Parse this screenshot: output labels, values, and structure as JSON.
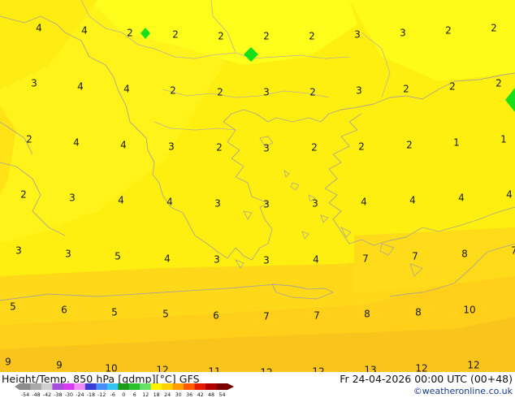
{
  "title": {
    "product": "Height/Temp. 850 hPa [gdmp][°C] GFS",
    "valid": "Fr 24-04-2026 00:00 UTC (00+48)",
    "credit": "©weatheronline.co.uk"
  },
  "colors": {
    "sea_deep": "#f7c51d",
    "field_warm": "#ffd31a",
    "field_yellow": "#ffef10",
    "field_bright": "#fffd1c",
    "coast": "#b0a78a",
    "marker": "#18e018"
  },
  "colorbar": {
    "labels": [
      "-54",
      "-48",
      "-42",
      "-38",
      "-30",
      "-24",
      "-18",
      "-12",
      "-6",
      "0",
      "6",
      "12",
      "18",
      "24",
      "30",
      "36",
      "42",
      "48",
      "54"
    ],
    "colors": [
      "#8c8c8c",
      "#a9a9a9",
      "#cfcfcf",
      "#a54fdb",
      "#d63bf0",
      "#f08cf5",
      "#3b3bd6",
      "#4a8cf5",
      "#33c4f5",
      "#1a9c1a",
      "#2ac22a",
      "#66e066",
      "#fff300",
      "#ffd000",
      "#ff9c00",
      "#ff5a00",
      "#e61a00",
      "#b00000",
      "#7a0000"
    ]
  },
  "temperature_values": [
    "4",
    "4",
    "2",
    "2",
    "2",
    "2",
    "2",
    "3",
    "3",
    "2",
    "2",
    "3",
    "4",
    "4",
    "2",
    "2",
    "3",
    "2",
    "3",
    "2",
    "2",
    "2",
    "2",
    "4",
    "4",
    "3",
    "2",
    "3",
    "2",
    "2",
    "2",
    "1",
    "1",
    "2",
    "3",
    "4",
    "4",
    "3",
    "3",
    "3",
    "4",
    "4",
    "4",
    "4",
    "3",
    "3",
    "5",
    "4",
    "3",
    "3",
    "4",
    "7",
    "7",
    "8",
    "7",
    "5",
    "6",
    "5",
    "5",
    "6",
    "7",
    "7",
    "8",
    "8",
    "10",
    "9",
    "9",
    "10",
    "12",
    "11",
    "12",
    "12",
    "13",
    "12",
    "12"
  ]
}
